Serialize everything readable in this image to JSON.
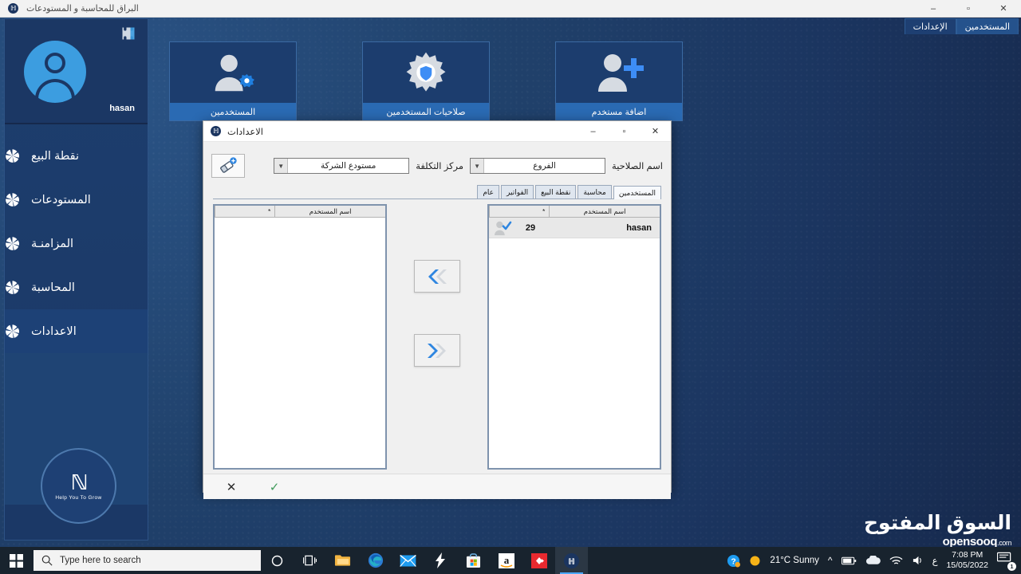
{
  "app": {
    "titlebar": {
      "title": "البراق للمحاسبة و المستودعات",
      "logo_icon": "app-logo-icon",
      "minimize": "–",
      "maximize": "▫",
      "close": "✕"
    },
    "tabs": [
      {
        "label": "المستخدمين",
        "active": true
      },
      {
        "label": "الإعدادات",
        "active": false
      }
    ],
    "cards": [
      {
        "label": "اضافة مستخدم",
        "icon": "user-plus-icon"
      },
      {
        "label": "صلاحيات المستخدمين",
        "icon": "gear-shield-icon"
      },
      {
        "label": "المستخدمين",
        "icon": "user-gear-icon"
      }
    ]
  },
  "sidebar": {
    "avatar_icon": "user-avatar-icon",
    "extension_icon": "puzzle-piece-icon",
    "user_name": "hasan",
    "items": [
      {
        "label": "نقطة البيع",
        "icon": "pinwheel-icon",
        "active": false
      },
      {
        "label": "المستودعات",
        "icon": "pinwheel-icon",
        "active": false
      },
      {
        "label": "المزامنـة",
        "icon": "pinwheel-icon",
        "active": false
      },
      {
        "label": "المحاسبة",
        "icon": "pinwheel-icon",
        "active": false
      },
      {
        "label": "الاعدادات",
        "icon": "pinwheel-icon",
        "active": true
      }
    ],
    "brand": {
      "mark": "ℕ",
      "tagline": "Help You To Grow"
    }
  },
  "dialog": {
    "title": "الاعدادات",
    "icon": "app-logo-icon",
    "minimize": "–",
    "maximize": "▫",
    "close": "✕",
    "filters": {
      "permission_label": "اسم الصلاحية",
      "branch_value": "الفروع",
      "cost_center_label": "مركز التكلفة",
      "warehouse_value": "مستودع الشركة",
      "eraser_icon": "eraser-add-icon",
      "dropdown_icon": "chevron-down-icon"
    },
    "tabs": [
      {
        "label": "المستخدمين",
        "active": true
      },
      {
        "label": "محاسبة",
        "active": false
      },
      {
        "label": "نقطة البيع",
        "active": false
      },
      {
        "label": "الفواتير",
        "active": false
      },
      {
        "label": "عام",
        "active": false
      }
    ],
    "left_grid": {
      "headers": {
        "name": "اسم المستخدم",
        "star": "*"
      },
      "rows": [
        {
          "icon": "user-checked-icon",
          "id": "29",
          "name": "hasan"
        }
      ]
    },
    "right_grid": {
      "headers": {
        "name": "اسم المستخدم",
        "star": "*"
      },
      "rows": []
    },
    "move_buttons": [
      {
        "name": "move-left-button",
        "icon": "double-chevron-left-icon"
      },
      {
        "name": "move-right-button",
        "icon": "double-chevron-right-icon"
      }
    ],
    "footer": {
      "cancel_icon": "✕",
      "confirm_icon": "✓"
    }
  },
  "watermark": {
    "arabic": "السوق المفتوح",
    "english": "opensooq",
    "suffix": ".com"
  },
  "taskbar": {
    "start_icon": "windows-start-icon",
    "search_placeholder": "Type here to search",
    "search_icon": "search-icon",
    "cortana_icon": "cortana-circle-icon",
    "taskview_icon": "task-view-icon",
    "apps": [
      {
        "icon": "file-explorer-icon",
        "active": false
      },
      {
        "icon": "edge-browser-icon",
        "active": false
      },
      {
        "icon": "mail-icon",
        "active": false
      },
      {
        "icon": "lightning-icon",
        "active": false
      },
      {
        "icon": "microsoft-store-icon",
        "active": false
      },
      {
        "icon": "amazon-icon",
        "active": false
      },
      {
        "icon": "red-diamond-icon",
        "active": false
      },
      {
        "icon": "burraq-app-icon",
        "active": true
      }
    ],
    "tray": {
      "help_icon": "help-circle-icon",
      "weather_icon": "sunny-icon",
      "weather_text": "21°C  Sunny",
      "chevron_up": "^",
      "battery_icon": "battery-icon",
      "onedrive_icon": "onedrive-cloud-icon",
      "wifi_icon": "wifi-icon",
      "sound_icon": "volume-icon",
      "lang": "ع",
      "time": "7:08 PM",
      "date": "15/05/2022",
      "notification_icon": "notification-icon",
      "notification_count": "1"
    }
  }
}
